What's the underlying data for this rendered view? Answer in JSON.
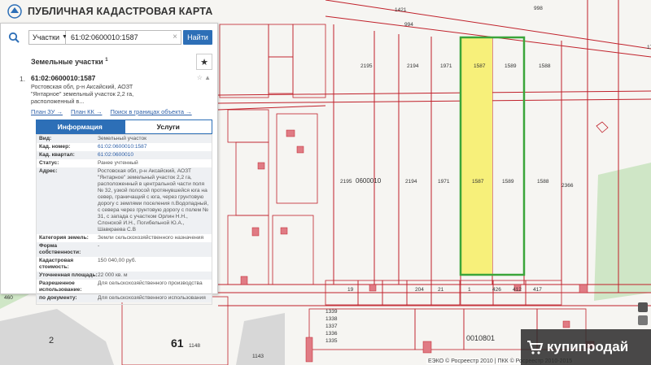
{
  "app": {
    "title": "ПУБЛИЧНАЯ КАДАСТРОВАЯ КАРТА"
  },
  "search": {
    "type_select": "Участки",
    "value": "61:02:0600010:1587",
    "button": "Найти"
  },
  "section": {
    "label": "Земельные участки",
    "superscript": "1"
  },
  "result": {
    "number": "1.",
    "code": "61:02:0600010:1587",
    "address": "Ростовская обл, р-н Аксайский, АОЗТ \"Янтарное\" земельный участок 2,2 га, расположенный в...",
    "links": [
      "План ЗУ →",
      "План КК →",
      "Поиск в границах объекта →"
    ]
  },
  "tabs": {
    "info": "Информация",
    "services": "Услуги"
  },
  "info_rows": [
    {
      "k": "Вид:",
      "v": "Земельный участок"
    },
    {
      "k": "Кад. номер:",
      "v": "61:02:0600010:1587"
    },
    {
      "k": "Кад. квартал:",
      "v": "61:02:0600010"
    },
    {
      "k": "Статус:",
      "v": "Ранее учтенный"
    },
    {
      "k": "Адрес:",
      "v": "Ростовская обл, р-н Аксайский, АОЗТ \"Янтарное\" земельный участок 2,2 га, расположенный в центральной части поля № 32, узкой полосой протянувшейся юга на север, граничащий с юга, через грунтовую дорогу с землями поселения п.Водопадный, с севера через грунтовую дорогу с полем № 31, с запада с участком Орлин Н.Н., Слонской И.Н., Погибельной Ю.А., Шавкраева С.В"
    },
    {
      "k": "Категория земель:",
      "v": "Земли сельскохозяйственного назначения"
    },
    {
      "k": "Форма собственности:",
      "v": "-"
    },
    {
      "k": "Кадастровая стоимость:",
      "v": "150 040,00 руб."
    },
    {
      "k": "Уточненная площадь:",
      "v": "22 000 кв. м"
    },
    {
      "k": "Разрешенное использование:",
      "v": "Для сельскохозяйственного производства"
    },
    {
      "k": "по документу:",
      "v": "Для сельскохозяйственного использования"
    }
  ],
  "map_labels": {
    "parcels_top": [
      "2195",
      "2194",
      "1971",
      "1587",
      "1589",
      "1588"
    ],
    "parcels_mid": [
      "2195",
      "0600010",
      "2194",
      "1971",
      "1587",
      "1589",
      "1588"
    ],
    "quarter": "0010801",
    "quarter2": "0010801",
    "district": "61",
    "zone": "2",
    "parcel_2366": "2366",
    "parcel_1786": "1786",
    "parcel_994": "994",
    "parcel_1421": "1421",
    "parcel_998": "998",
    "bottom_row": [
      "19",
      "1",
      "204",
      "21",
      "426",
      "412",
      "417"
    ],
    "small_left": [
      "1425",
      "1",
      "460",
      "1148",
      "1339",
      "1338",
      "1337",
      "1336",
      "1335",
      "1143"
    ]
  },
  "footer": {
    "copyright": "ЕЭКО © Росреестр 2010 | ПКК © Росреестр 2010-2015"
  },
  "watermark": {
    "text": "купипродай"
  },
  "colors": {
    "accent": "#2d6fb7",
    "selected_fill": "#f7f07a",
    "selected_border": "#3aa53a",
    "parcel_line": "#c0202a",
    "building": "#e07b84",
    "green_zone": "#cfe6c6"
  }
}
